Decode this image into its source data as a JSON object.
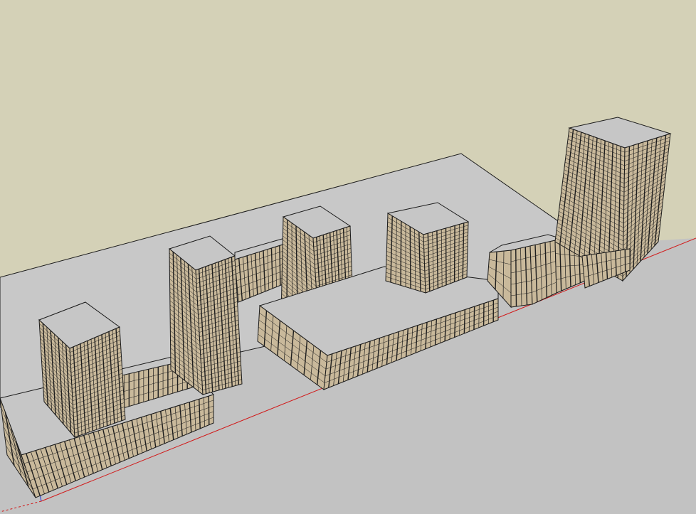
{
  "viewport": {
    "sky_color": "#d4d1b7",
    "ground_color": "#c2c2c2",
    "site_pad_color": "#c8c8c8",
    "edge_color": "#1a1a1a",
    "facade_color": "#c9b99b",
    "roof_color": "#c6c6c6",
    "window_color": "#1e1e1e",
    "x_axis_color": "#d11a1a",
    "z_axis_color": "#1c2bd6"
  },
  "scene": {
    "model": [
      "site-pad",
      "podium-west",
      "tower-west",
      "tower-center-left",
      "skybridge",
      "tower-center-right",
      "podium-center",
      "tower-east-mid",
      "low-blocks-east",
      "tower-east-high"
    ]
  }
}
